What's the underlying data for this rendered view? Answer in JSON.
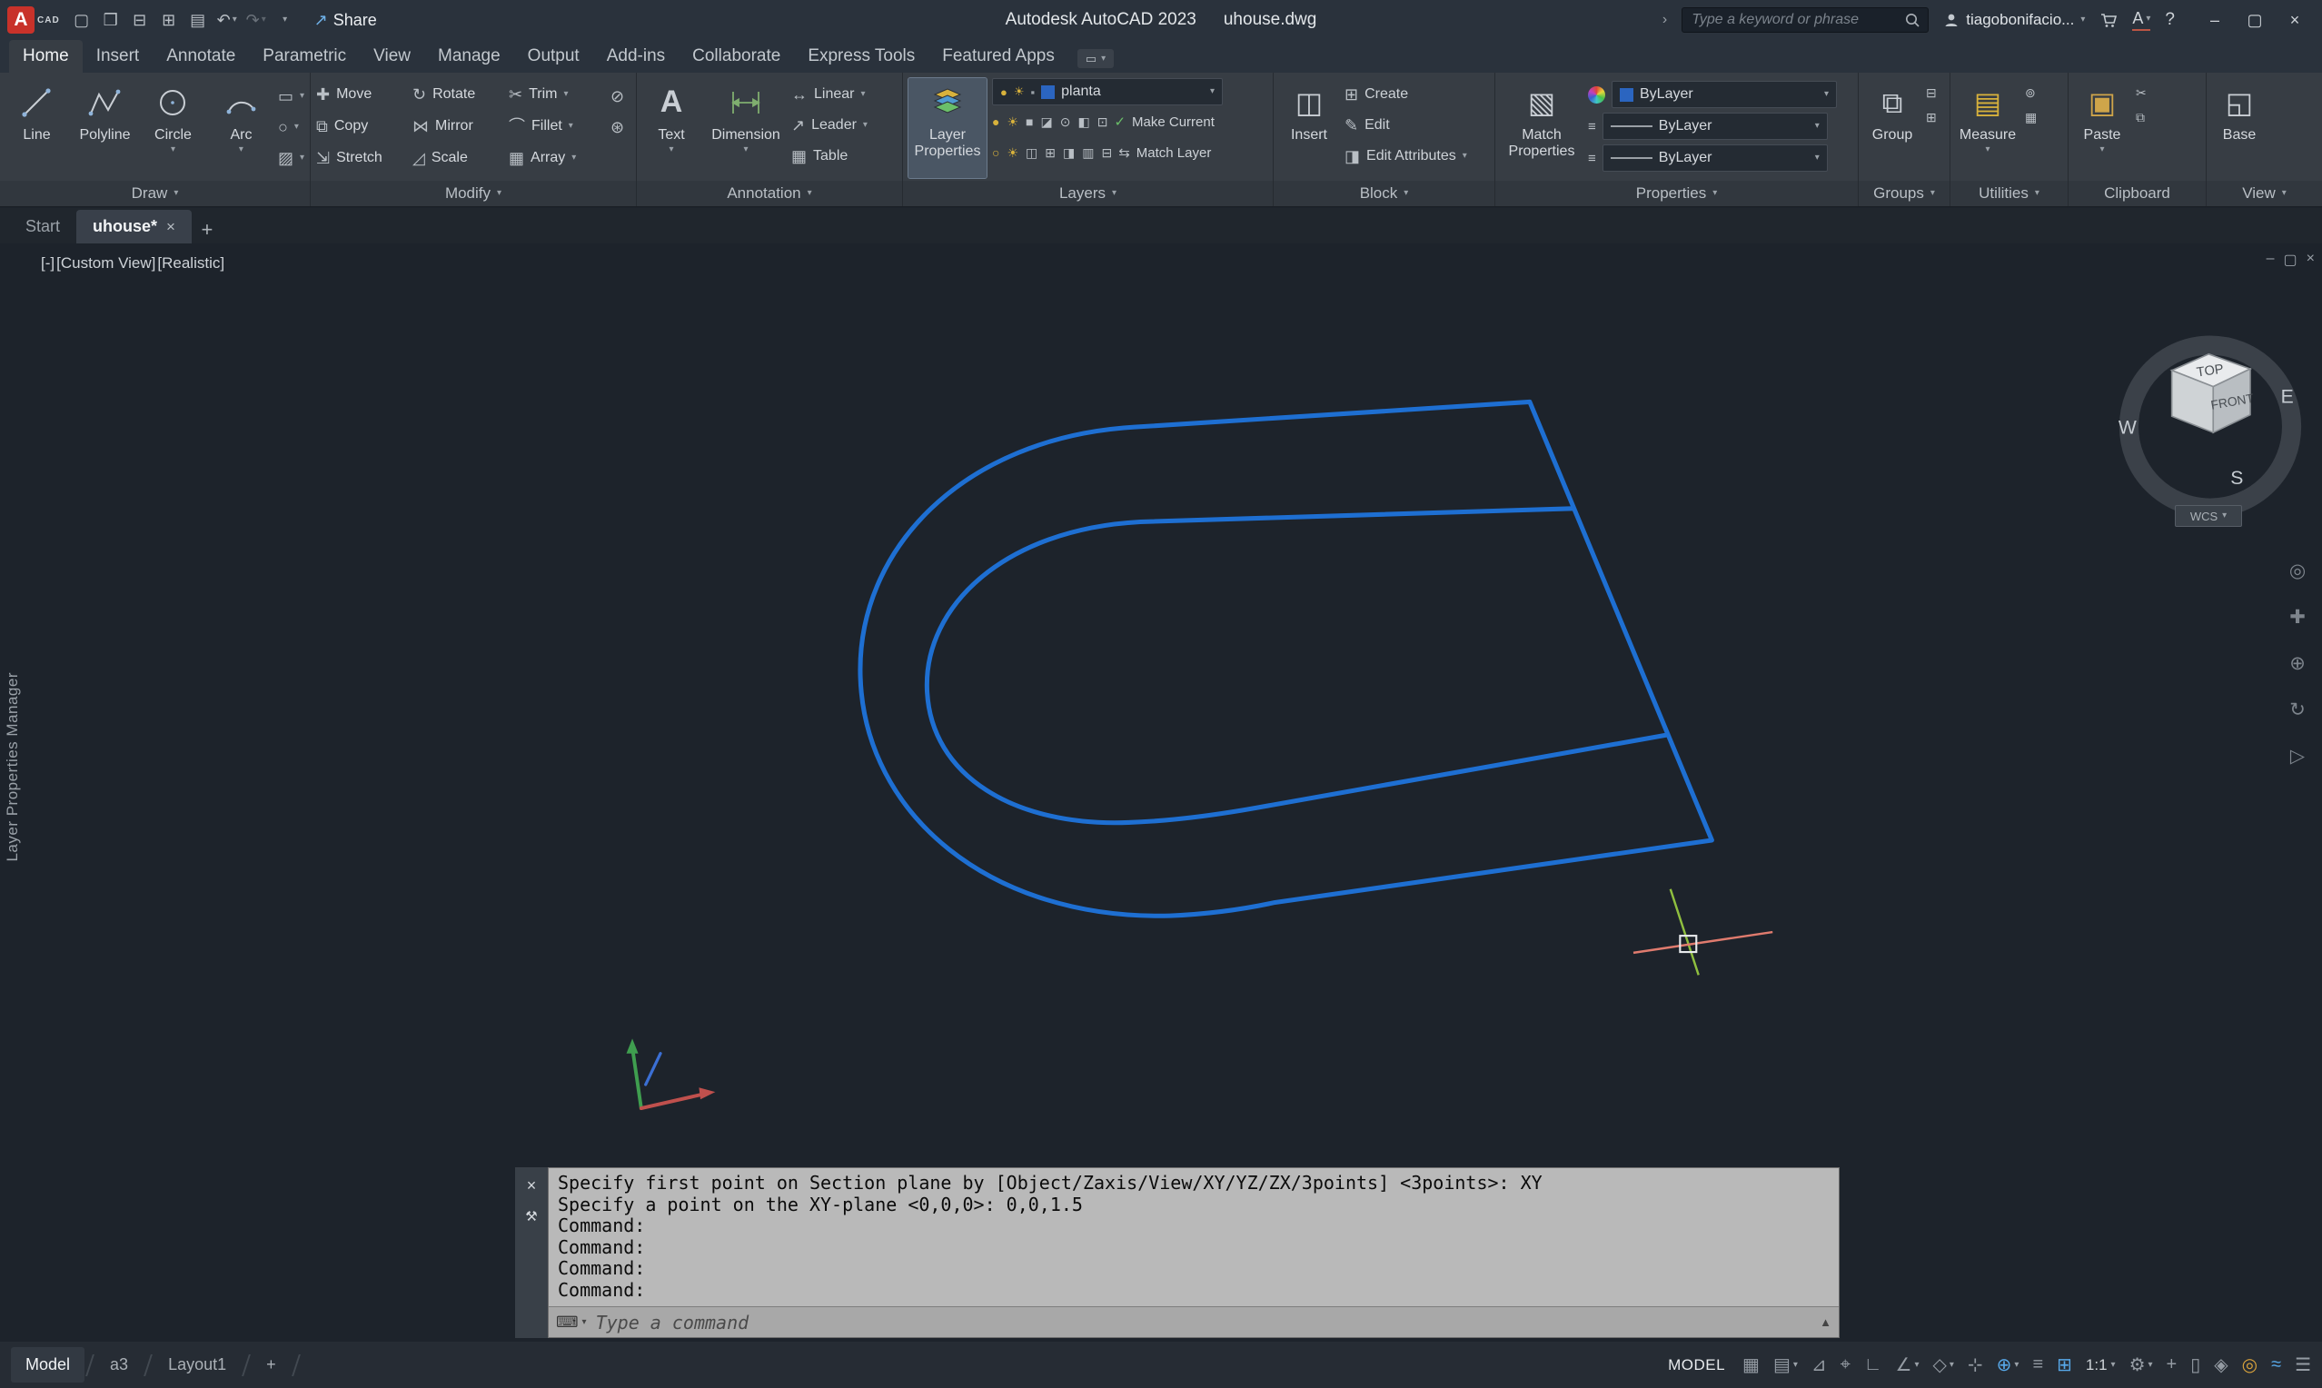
{
  "titlebar": {
    "logo_text": "A",
    "logo_sub": "CAD",
    "share_label": "Share",
    "app_title": "Autodesk AutoCAD 2023",
    "doc_name": "uhouse.dwg",
    "search_placeholder": "Type a keyword or phrase",
    "user_name": "tiagobonifacio...",
    "trial_label": "A"
  },
  "icons": {
    "caret": "▾",
    "chev": "›",
    "close": "×",
    "min": "–",
    "max": "▢",
    "new_file": "▢",
    "open_file": "❒",
    "save": "⊟",
    "save_as": "⊞",
    "print": "▤",
    "undo": "↶",
    "redo": "↷",
    "share": "↗",
    "help": "?",
    "move": "✚",
    "rotate": "↻",
    "trim": "✂",
    "copy": "⧉",
    "mirror": "⋈",
    "fillet": "⌒",
    "stretch": "⇲",
    "scale": "◿",
    "array": "▦",
    "erase": "⊘",
    "explode": "⊛",
    "rect": "▭",
    "ellipse": "○",
    "hatch": "▨",
    "text": "A",
    "linear": "↔",
    "leader": "↗",
    "table": "▦",
    "make_current": "✓",
    "match_layer": "⇆",
    "insert": "◫",
    "create": "⊞",
    "edit": "✎",
    "edit_attrs": "◨",
    "match_props": "▧",
    "listlines": "≡",
    "group": "⧉",
    "ungroup": "⊟",
    "group_edit": "⊞",
    "measure": "▤",
    "quick_select": "⊚",
    "quick_calc": "▦",
    "paste": "▣",
    "cut": "✂",
    "copy_clip": "⧉",
    "base": "◱",
    "wrench": "⚒",
    "keyboard": "⌨",
    "up": "▲",
    "wheel": "◎",
    "pan": "✚",
    "zoom": "⊕",
    "orbit": "↻",
    "motion": "▷"
  },
  "ribbon_tabs": [
    {
      "label": "Home",
      "active": true
    },
    {
      "label": "Insert"
    },
    {
      "label": "Annotate"
    },
    {
      "label": "Parametric"
    },
    {
      "label": "View"
    },
    {
      "label": "Manage"
    },
    {
      "label": "Output"
    },
    {
      "label": "Add-ins"
    },
    {
      "label": "Collaborate"
    },
    {
      "label": "Express Tools"
    },
    {
      "label": "Featured Apps"
    }
  ],
  "panels": {
    "draw": {
      "title": "Draw",
      "tools": [
        "Line",
        "Polyline",
        "Circle",
        "Arc"
      ]
    },
    "modify": {
      "title": "Modify",
      "rows": [
        [
          "Move",
          "Rotate",
          "Trim"
        ],
        [
          "Copy",
          "Mirror",
          "Fillet"
        ],
        [
          "Stretch",
          "Scale",
          "Array"
        ]
      ]
    },
    "annotation": {
      "title": "Annotation",
      "large": [
        "Text",
        "Dimension"
      ],
      "small": [
        "Linear",
        "Leader",
        "Table"
      ]
    },
    "layers": {
      "title": "Layers",
      "large": "Layer Properties",
      "dropdown": "planta",
      "drop_icons": [
        "●",
        "☀",
        "▪"
      ],
      "tools_a": [
        "●",
        "☀",
        "■",
        "◪",
        "⊙",
        "◧",
        "⊡"
      ],
      "tools_b": [
        "○",
        "☀",
        "◫",
        "⊞",
        "◨",
        "▥",
        "⊟"
      ],
      "buttons": [
        "Make Current",
        "Match Layer"
      ]
    },
    "block": {
      "title": "Block",
      "large": "Insert",
      "small": [
        "Create",
        "Edit",
        "Edit Attributes"
      ]
    },
    "properties": {
      "title": "Properties",
      "large": "Match Properties",
      "fields": [
        "ByLayer",
        "ByLayer",
        "ByLayer"
      ]
    },
    "groups": {
      "title": "Groups",
      "large": "Group"
    },
    "utilities": {
      "title": "Utilities",
      "large": "Measure"
    },
    "clipboard": {
      "title": "Clipboard",
      "large": "Paste"
    },
    "view": {
      "title": "View",
      "large": "Base"
    }
  },
  "file_tabs": {
    "items": [
      {
        "label": "Start",
        "active": false
      },
      {
        "label": "uhouse*",
        "active": true
      }
    ],
    "add": "+"
  },
  "viewport": {
    "controls": [
      "[-]",
      "[Custom View]",
      "[Realistic]"
    ]
  },
  "viewcube": {
    "top": "TOP",
    "front": "FRONT",
    "w": "W",
    "s": "S",
    "e": "E",
    "wcs": "WCS"
  },
  "left_palette_label": "Layer Properties Manager",
  "command": {
    "history": [
      "Specify first point on Section plane by [Object/Zaxis/View/XY/YZ/ZX/3points] <3points>: XY",
      "Specify a point on the XY-plane <0,0,0>: 0,0,1.5",
      "Command:",
      "Command:",
      "Command:",
      "Command:"
    ],
    "placeholder": "Type a command"
  },
  "status": {
    "tabs": [
      {
        "label": "Model",
        "active": true
      },
      {
        "label": "a3"
      },
      {
        "label": "Layout1"
      }
    ],
    "add": "+",
    "model": "MODEL",
    "scale": "1:1",
    "icons": [
      {
        "name": "grid",
        "g": "▦"
      },
      {
        "name": "snap-mode",
        "g": "▤"
      },
      {
        "name": "infer-constraints",
        "g": "⊿"
      },
      {
        "name": "dynamic-input",
        "g": "⌖"
      },
      {
        "name": "ortho-mode",
        "g": "∟"
      },
      {
        "name": "polar-tracking",
        "g": "∠"
      },
      {
        "name": "isometric-drafting",
        "g": "◇"
      },
      {
        "name": "object-snap-tracking",
        "g": "⊹"
      },
      {
        "name": "object-snap",
        "g": "⊕"
      },
      {
        "name": "lineweight",
        "g": "≡"
      },
      {
        "name": "selection-cycling",
        "g": "⊞"
      },
      {
        "name": "workspace-switching",
        "g": "⚙"
      },
      {
        "name": "annotation-monitor",
        "g": "+"
      },
      {
        "name": "quick-properties",
        "g": "▯"
      },
      {
        "name": "lock-ui",
        "g": "◈"
      },
      {
        "name": "isolate-objects",
        "g": "◎"
      },
      {
        "name": "hardware-acceleration",
        "g": "≈"
      },
      {
        "name": "clean-screen",
        "g": "☰"
      }
    ]
  },
  "drawing_colors": {
    "polyline_blue": "#1e6fd2",
    "axis_green": "#8fbf3f",
    "axis_red": "#e07b6e",
    "ucs_green": "#3f9e4f",
    "ucs_red": "#c0504d",
    "ucs_blue": "#3b6fd4"
  }
}
